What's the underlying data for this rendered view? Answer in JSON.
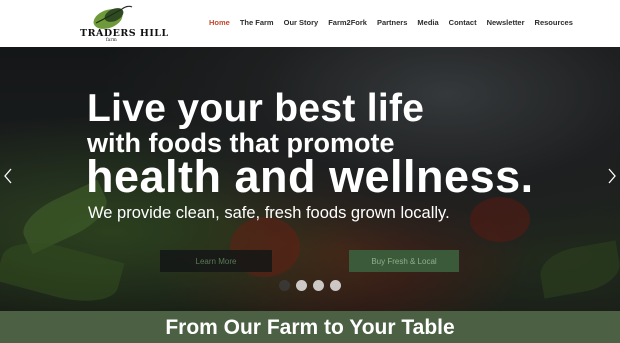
{
  "brand": {
    "name": "TRADERS HILL",
    "sub": "farm",
    "accent": "#c0492f",
    "green": "#4c6044"
  },
  "nav": {
    "items": [
      {
        "label": "Home",
        "active": true
      },
      {
        "label": "The Farm"
      },
      {
        "label": "Our Story"
      },
      {
        "label": "Farm2Fork"
      },
      {
        "label": "Partners"
      },
      {
        "label": "Media"
      },
      {
        "label": "Contact"
      },
      {
        "label": "Newsletter"
      },
      {
        "label": "Resources"
      }
    ]
  },
  "hero": {
    "line1": "Live your best life",
    "line2": "with foods that promote",
    "line3": "health and wellness.",
    "tagline": "We provide clean, safe, fresh foods grown locally.",
    "learn_label": "Learn More",
    "buy_label": "Buy Fresh & Local",
    "prev_icon": "chevron-left-icon",
    "next_icon": "chevron-right-icon",
    "slide_count": 4,
    "active_slide": 2
  },
  "section": {
    "title": "From Our Farm to Your Table"
  }
}
